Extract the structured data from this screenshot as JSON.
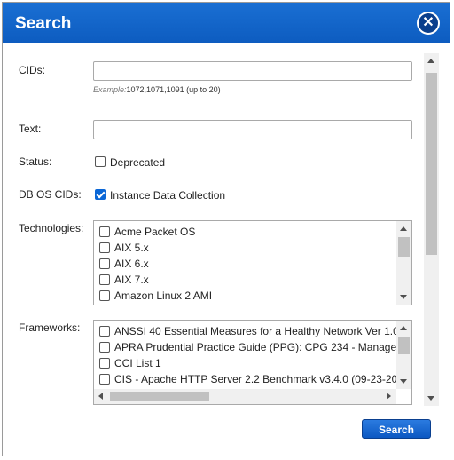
{
  "dialog": {
    "title": "Search",
    "close_icon": "close-icon",
    "accent_color": "#0d5cc0"
  },
  "form": {
    "cids": {
      "label": "CIDs:",
      "value": "",
      "hint_prefix": "Example:",
      "hint_text": "1072,1071,1091 (up to 20)"
    },
    "text": {
      "label": "Text:",
      "value": ""
    },
    "status": {
      "label": "Status:",
      "option": "Deprecated",
      "checked": false
    },
    "db_os_cids": {
      "label": "DB OS CIDs:",
      "option": "Instance Data Collection",
      "checked": true
    },
    "technologies": {
      "label": "Technologies:",
      "items": [
        "Acme Packet OS",
        "AIX 5.x",
        "AIX 6.x",
        "AIX 7.x",
        "Amazon Linux 2 AMI"
      ]
    },
    "frameworks": {
      "label": "Frameworks:",
      "items": [
        "ANSSI 40 Essential Measures for a Healthy Network Ver 1.0",
        "APRA Prudential Practice Guide (PPG): CPG 234 - Manage",
        "CCI List 1",
        "CIS - Apache HTTP Server 2.2 Benchmark v3.4.0 (09-23-20"
      ]
    }
  },
  "footer": {
    "search_label": "Search"
  }
}
